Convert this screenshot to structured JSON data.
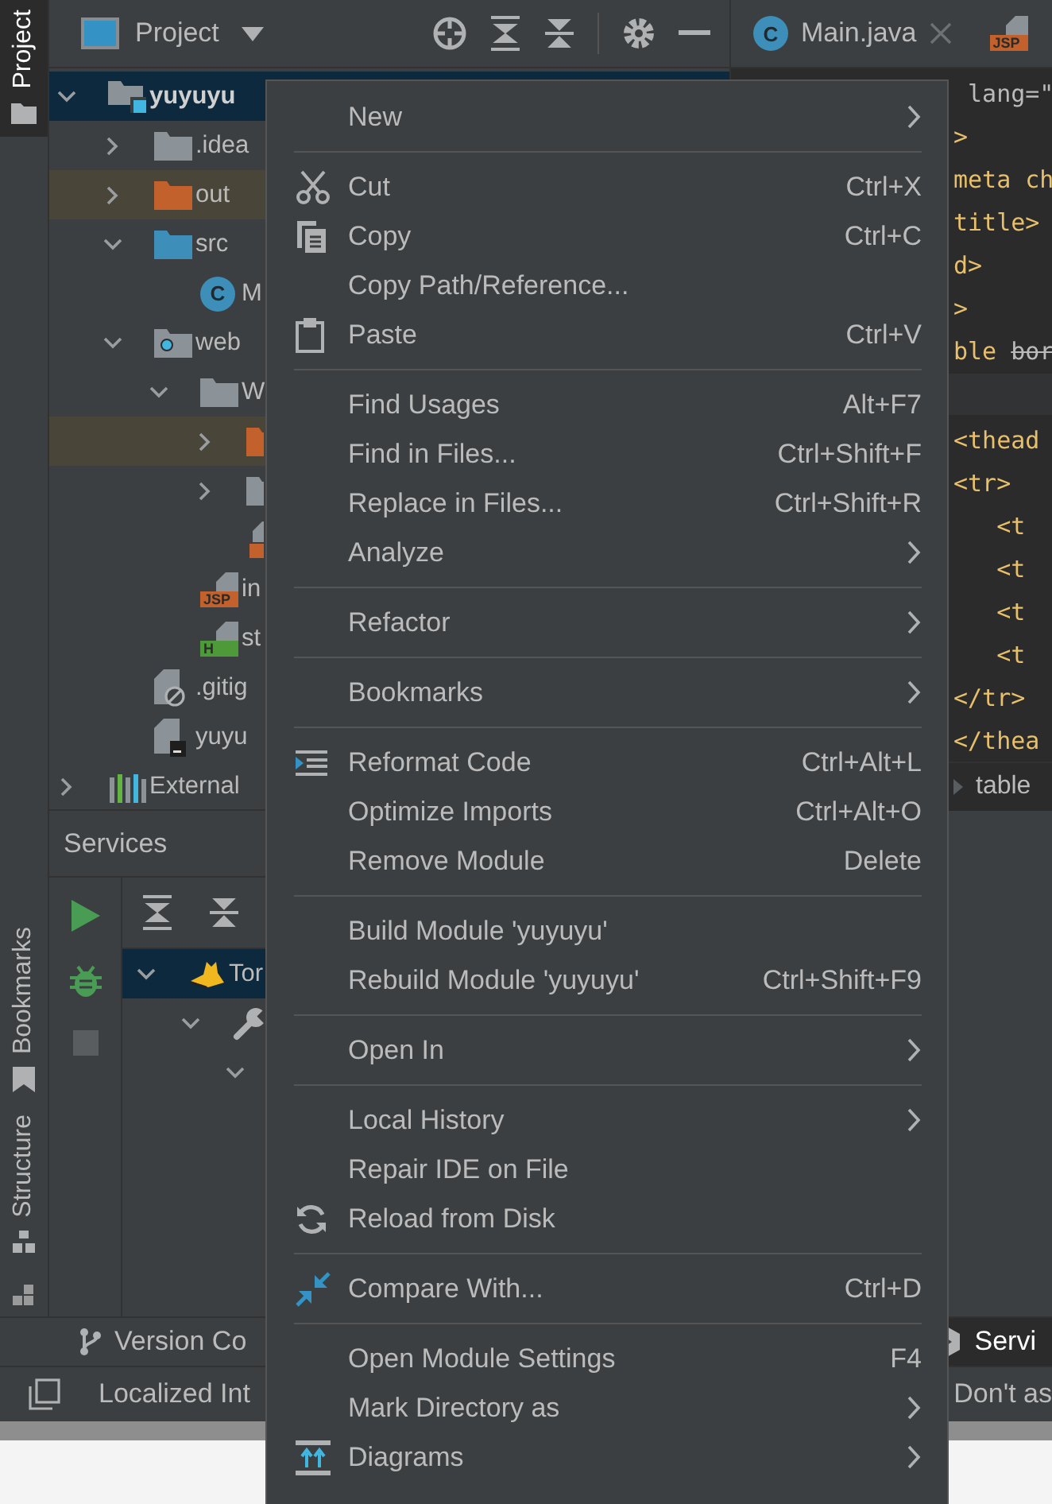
{
  "left_stripe": [
    {
      "label": "Project",
      "selected": true
    },
    {
      "label": "Bookmarks",
      "selected": false
    },
    {
      "label": "Structure",
      "selected": false
    }
  ],
  "project_panel": {
    "title": "Project"
  },
  "project_tree": [
    {
      "label": "yuyuyu",
      "kind": "module",
      "selected": true,
      "expanded": true,
      "children": [
        {
          "label": ".idea",
          "kind": "folder",
          "selected": false,
          "expanded": false
        },
        {
          "label": "out",
          "kind": "excluded-folder",
          "selected": false,
          "expanded": false
        },
        {
          "label": "src",
          "kind": "source-folder",
          "selected": false,
          "expanded": true,
          "children": [
            {
              "label": "M",
              "kind": "class",
              "badge": "C",
              "selected": false
            }
          ]
        },
        {
          "label": "web",
          "kind": "web-folder",
          "selected": false,
          "expanded": true,
          "children": [
            {
              "label": "W",
              "kind": "folder",
              "selected": false,
              "expanded": true,
              "children": [
                {
                  "kind": "excluded-folder",
                  "selected": false,
                  "expanded": false
                },
                {
                  "kind": "folder",
                  "selected": false,
                  "expanded": false
                },
                {
                  "kind": "markup-file",
                  "selected": false
                }
              ]
            },
            {
              "label": "in",
              "kind": "jsp-file",
              "badge": "JSP",
              "selected": false
            },
            {
              "label": "st",
              "kind": "html-file",
              "badge": "H",
              "selected": false
            }
          ]
        },
        {
          "label": ".gitig",
          "kind": "ignore-file",
          "selected": false
        },
        {
          "label": "yuyu",
          "kind": "file",
          "selected": false
        }
      ]
    },
    {
      "label": "External",
      "kind": "library",
      "selected": false,
      "expanded": false
    }
  ],
  "services": {
    "title": "Services",
    "tree": [
      {
        "label": "Tor",
        "kind": "tomcat",
        "selected": true,
        "expanded": true,
        "children": [
          {
            "kind": "wrench",
            "selected": false,
            "expanded": true,
            "children": [
              {
                "selected": false,
                "expanded": true
              }
            ]
          }
        ]
      }
    ]
  },
  "editor_tabs": [
    {
      "label": "Main.java",
      "badge": "C"
    },
    {
      "badge": "JSP"
    }
  ],
  "code_top": [
    {
      "text": " lang=\"",
      "kind": "attr"
    },
    {
      "text": ">",
      "kind": "tag"
    },
    {
      "text": "meta ch",
      "kind": "tag"
    },
    {
      "text": "title>",
      "kind": "tag"
    },
    {
      "text": "d>",
      "kind": "tag"
    },
    {
      "text": ">",
      "kind": "tag"
    },
    {
      "text": "ble ",
      "kind": "tag",
      "struck_text": "bor"
    }
  ],
  "code_bottom": [
    {
      "text": "<thead",
      "kind": "tag"
    },
    {
      "text": "<tr>",
      "kind": "tag"
    },
    {
      "text": "   <t",
      "kind": "tag"
    },
    {
      "text": "   <t",
      "kind": "tag"
    },
    {
      "text": "   <t",
      "kind": "tag"
    },
    {
      "text": "   <t",
      "kind": "tag"
    },
    {
      "text": "</tr>",
      "kind": "tag"
    },
    {
      "text": "</thea",
      "kind": "tag"
    }
  ],
  "breadcrumb": "table",
  "context_menu": [
    {
      "kind": "item",
      "label": "New",
      "submenu": true
    },
    {
      "kind": "separator"
    },
    {
      "kind": "item",
      "label": "Cut",
      "shortcut": "Ctrl+X",
      "icon": true
    },
    {
      "kind": "item",
      "label": "Copy",
      "shortcut": "Ctrl+C",
      "icon": true
    },
    {
      "kind": "item",
      "label": "Copy Path/Reference..."
    },
    {
      "kind": "item",
      "label": "Paste",
      "shortcut": "Ctrl+V",
      "icon": true
    },
    {
      "kind": "separator"
    },
    {
      "kind": "item",
      "label": "Find Usages",
      "shortcut": "Alt+F7"
    },
    {
      "kind": "item",
      "label": "Find in Files...",
      "shortcut": "Ctrl+Shift+F"
    },
    {
      "kind": "item",
      "label": "Replace in Files...",
      "shortcut": "Ctrl+Shift+R"
    },
    {
      "kind": "item",
      "label": "Analyze",
      "submenu": true
    },
    {
      "kind": "separator"
    },
    {
      "kind": "item",
      "label": "Refactor",
      "submenu": true
    },
    {
      "kind": "separator"
    },
    {
      "kind": "item",
      "label": "Bookmarks",
      "submenu": true
    },
    {
      "kind": "separator"
    },
    {
      "kind": "item",
      "label": "Reformat Code",
      "shortcut": "Ctrl+Alt+L",
      "icon": true
    },
    {
      "kind": "item",
      "label": "Optimize Imports",
      "shortcut": "Ctrl+Alt+O"
    },
    {
      "kind": "item",
      "label": "Remove Module",
      "shortcut": "Delete"
    },
    {
      "kind": "separator"
    },
    {
      "kind": "item",
      "label": "Build Module 'yuyuyu'"
    },
    {
      "kind": "item",
      "label": "Rebuild Module 'yuyuyu'",
      "shortcut": "Ctrl+Shift+F9"
    },
    {
      "kind": "separator"
    },
    {
      "kind": "item",
      "label": "Open In",
      "submenu": true
    },
    {
      "kind": "separator"
    },
    {
      "kind": "item",
      "label": "Local History",
      "submenu": true
    },
    {
      "kind": "item",
      "label": "Repair IDE on File"
    },
    {
      "kind": "item",
      "label": "Reload from Disk",
      "icon": true
    },
    {
      "kind": "separator"
    },
    {
      "kind": "item",
      "label": "Compare With...",
      "shortcut": "Ctrl+D",
      "icon": true
    },
    {
      "kind": "separator"
    },
    {
      "kind": "item",
      "label": "Open Module Settings",
      "shortcut": "F4"
    },
    {
      "kind": "item",
      "label": "Mark Directory as",
      "submenu": true
    },
    {
      "kind": "item",
      "label": "Diagrams",
      "icon": true,
      "submenu": true
    }
  ],
  "tool_windows": [
    {
      "label": "Version Co",
      "selected": false
    },
    {
      "label": "Servi",
      "selected": true
    }
  ],
  "status_bar": {
    "left": "Localized Int",
    "right": "Don't as"
  }
}
